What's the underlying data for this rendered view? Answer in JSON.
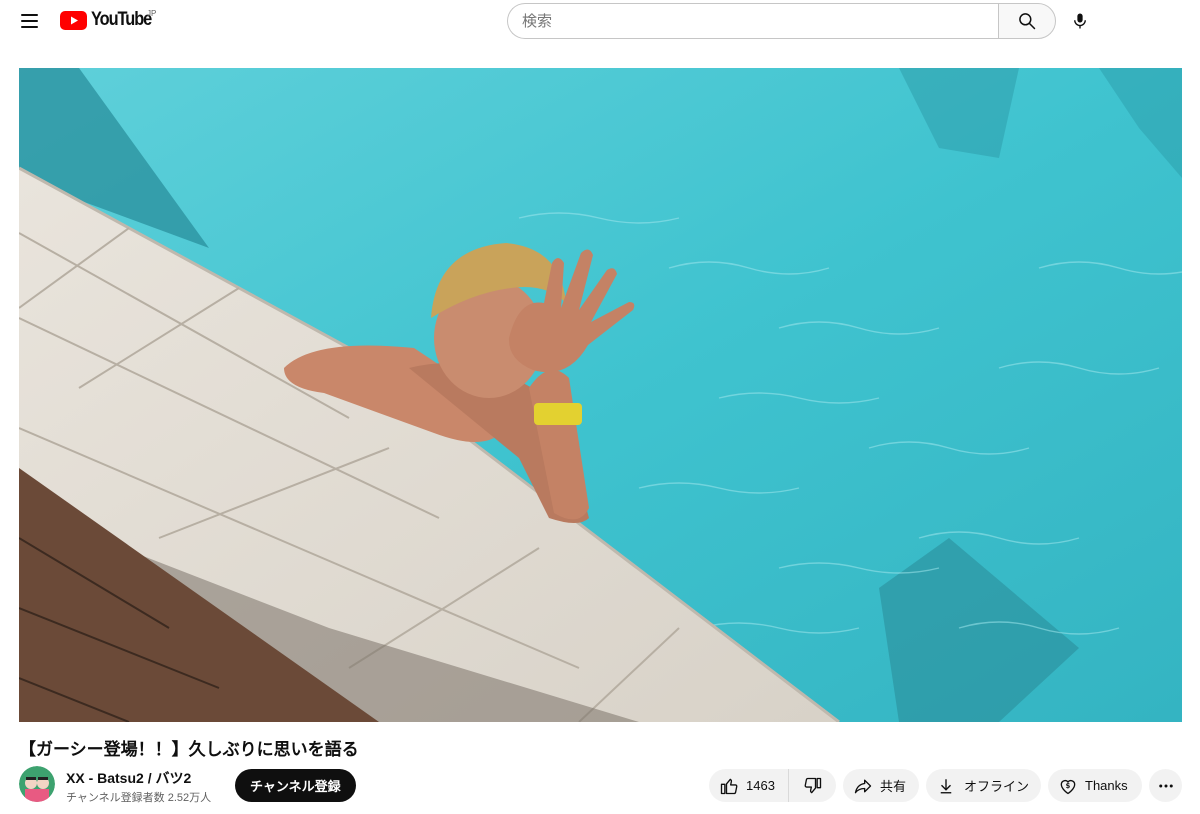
{
  "header": {
    "logo_text": "YouTube",
    "region": "JP",
    "search_placeholder": "検索"
  },
  "video": {
    "title": "【ガーシー登場！！】久しぶりに思いを語る"
  },
  "channel": {
    "name": "XX - Batsu2 / バツ2",
    "subscribers": "チャンネル登録者数 2.52万人",
    "subscribe_label": "チャンネル登録"
  },
  "actions": {
    "like_count": "1463",
    "share_label": "共有",
    "offline_label": "オフライン",
    "thanks_label": "Thanks"
  },
  "icons": {
    "menu": "hamburger-menu-icon",
    "search": "search-icon",
    "mic": "microphone-icon",
    "like": "thumbs-up-icon",
    "dislike": "thumbs-down-icon",
    "share": "share-arrow-icon",
    "download": "download-icon",
    "thanks": "super-thanks-icon",
    "more": "more-horizontal-icon"
  },
  "colors": {
    "brand_red": "#ff0000",
    "subscribe_bg": "#0f0f0f",
    "pill_bg": "#f2f2f2",
    "pool_water": "#3fc0cd"
  }
}
